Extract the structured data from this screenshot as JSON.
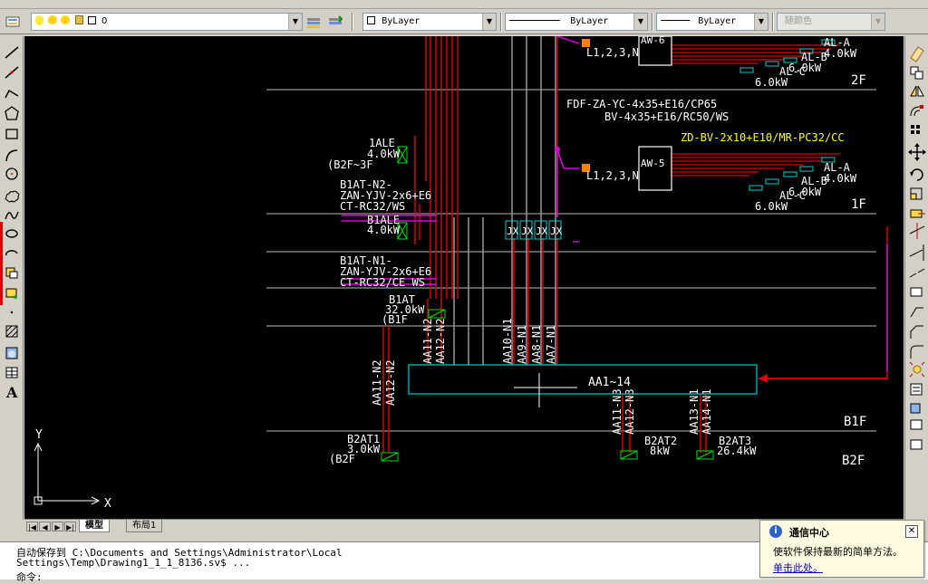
{
  "toolbar": {
    "layer_name": "0",
    "color": "ByLayer",
    "linetype": "ByLayer",
    "lineweight": "ByLayer",
    "plotstyle": "随颜色"
  },
  "tabs": [
    "模型",
    "布局1"
  ],
  "command": {
    "line1": "自动保存到 C:\\Documents and Settings\\Administrator\\Local",
    "line2": "Settings\\Temp\\Drawing1_1_1_8136.sv$ ...",
    "line3": "命令:"
  },
  "notification": {
    "title": "通信中心",
    "message": "使软件保持最新的简单方法。",
    "link": "单击此处。"
  },
  "ucs": {
    "x": "X",
    "y": "Y"
  },
  "drawing": {
    "floors": [
      "2F",
      "1F",
      "B1F",
      "B2F"
    ],
    "labels": {
      "aw6_top": "L1,2,3,N",
      "aw6": "AW-6",
      "al_a_2f": "AL-A",
      "al_b_2f": "AL-B",
      "al_c_2f": "AL-C",
      "kw_a_2f": "4.0kW",
      "kw_b_2f": "6.0kW",
      "kw_c_2f": "6.0kW",
      "fdf": "FDF-ZA-YC-4x35+E16/CP65",
      "bv": "BV-4x35+E16/RC50/WS",
      "zd": "ZD-BV-2x10+E10/MR-PC32/CC",
      "aw5_top": "L1,2,3,N",
      "aw5": "AW-5",
      "al_a_1f": "AL-A",
      "al_b_1f": "AL-B",
      "al_c_1f": "AL-C",
      "kw_a_1f": "4.0kW",
      "kw_b_1f": "6.0kW",
      "kw_c_1f": "6.0kW",
      "ale1": "1ALE",
      "ale1_kw": "4.0kW",
      "ale1_range": "(B2F~3F",
      "b1at_n2": "B1AT-N2-",
      "zan_n2": "ZAN-YJV-2x6+E6",
      "ct_n2": "CT-RC32/WS",
      "b1ale": "B1ALE",
      "b1ale_kw": "4.0kW",
      "b1at_n1": "B1AT-N1-",
      "zan_n1": "ZAN-YJV-2x6+E6",
      "ct_n1": "CT-RC32/CE WS",
      "b1at": "B1AT",
      "b1at_kw": "32.0kW",
      "b1at_floor": "(B1F",
      "jx": "JX",
      "busbar": "AA1~14",
      "aa11_n2": "AA11-N2",
      "aa12_n2": "AA12-N2",
      "aa10_n1": "AA10-N1",
      "aa9_n1": "AA9-N1",
      "aa8_n1": "AA8-N1",
      "aa7_n1": "AA7-N1",
      "aa11_n3": "AA11-N3",
      "aa12_n3": "AA12-N3",
      "aa13_n1": "AA13-N1",
      "aa14_n1": "AA14-N1",
      "b2at1": "B2AT1",
      "b2at1_kw": "3.0kW",
      "b2at1_floor": "(B2F",
      "b2at2": "B2AT2",
      "b2at2_kw": "8kW",
      "b2at3": "B2AT3",
      "b2at3_kw": "26.4kW"
    }
  }
}
